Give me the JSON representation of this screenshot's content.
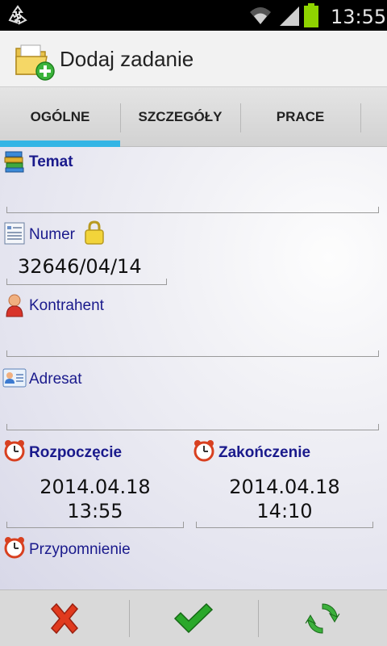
{
  "status_bar": {
    "time": "13:55",
    "icons": [
      "recycle-icon",
      "wifi-icon",
      "signal-icon",
      "battery-icon"
    ]
  },
  "action_bar": {
    "title": "Dodaj zadanie",
    "icon": "folder-add-icon"
  },
  "tabs": [
    {
      "label": "OGÓLNE",
      "selected": true
    },
    {
      "label": "SZCZEGÓŁY",
      "selected": false
    },
    {
      "label": "PRACE",
      "selected": false
    }
  ],
  "form": {
    "temat": {
      "label": "Temat",
      "value": ""
    },
    "numer": {
      "label": "Numer",
      "value": "32646/04/14",
      "locked": true
    },
    "kontrahent": {
      "label": "Kontrahent",
      "value": ""
    },
    "adresat": {
      "label": "Adresat",
      "value": ""
    },
    "rozpoczecie": {
      "label": "Rozpoczęcie",
      "date": "2014.04.18",
      "time": "13:55"
    },
    "zakonczenie": {
      "label": "Zakończenie",
      "date": "2014.04.18",
      "time": "14:10"
    },
    "przypomnienie": {
      "label": "Przypomnienie"
    }
  },
  "bottom_bar": {
    "buttons": [
      "cancel-icon",
      "confirm-icon",
      "refresh-icon"
    ]
  },
  "colors": {
    "accent": "#33b5e5",
    "label_text": "#1a1a8c",
    "cancel": "#e03a1e",
    "confirm": "#2aa82a"
  }
}
